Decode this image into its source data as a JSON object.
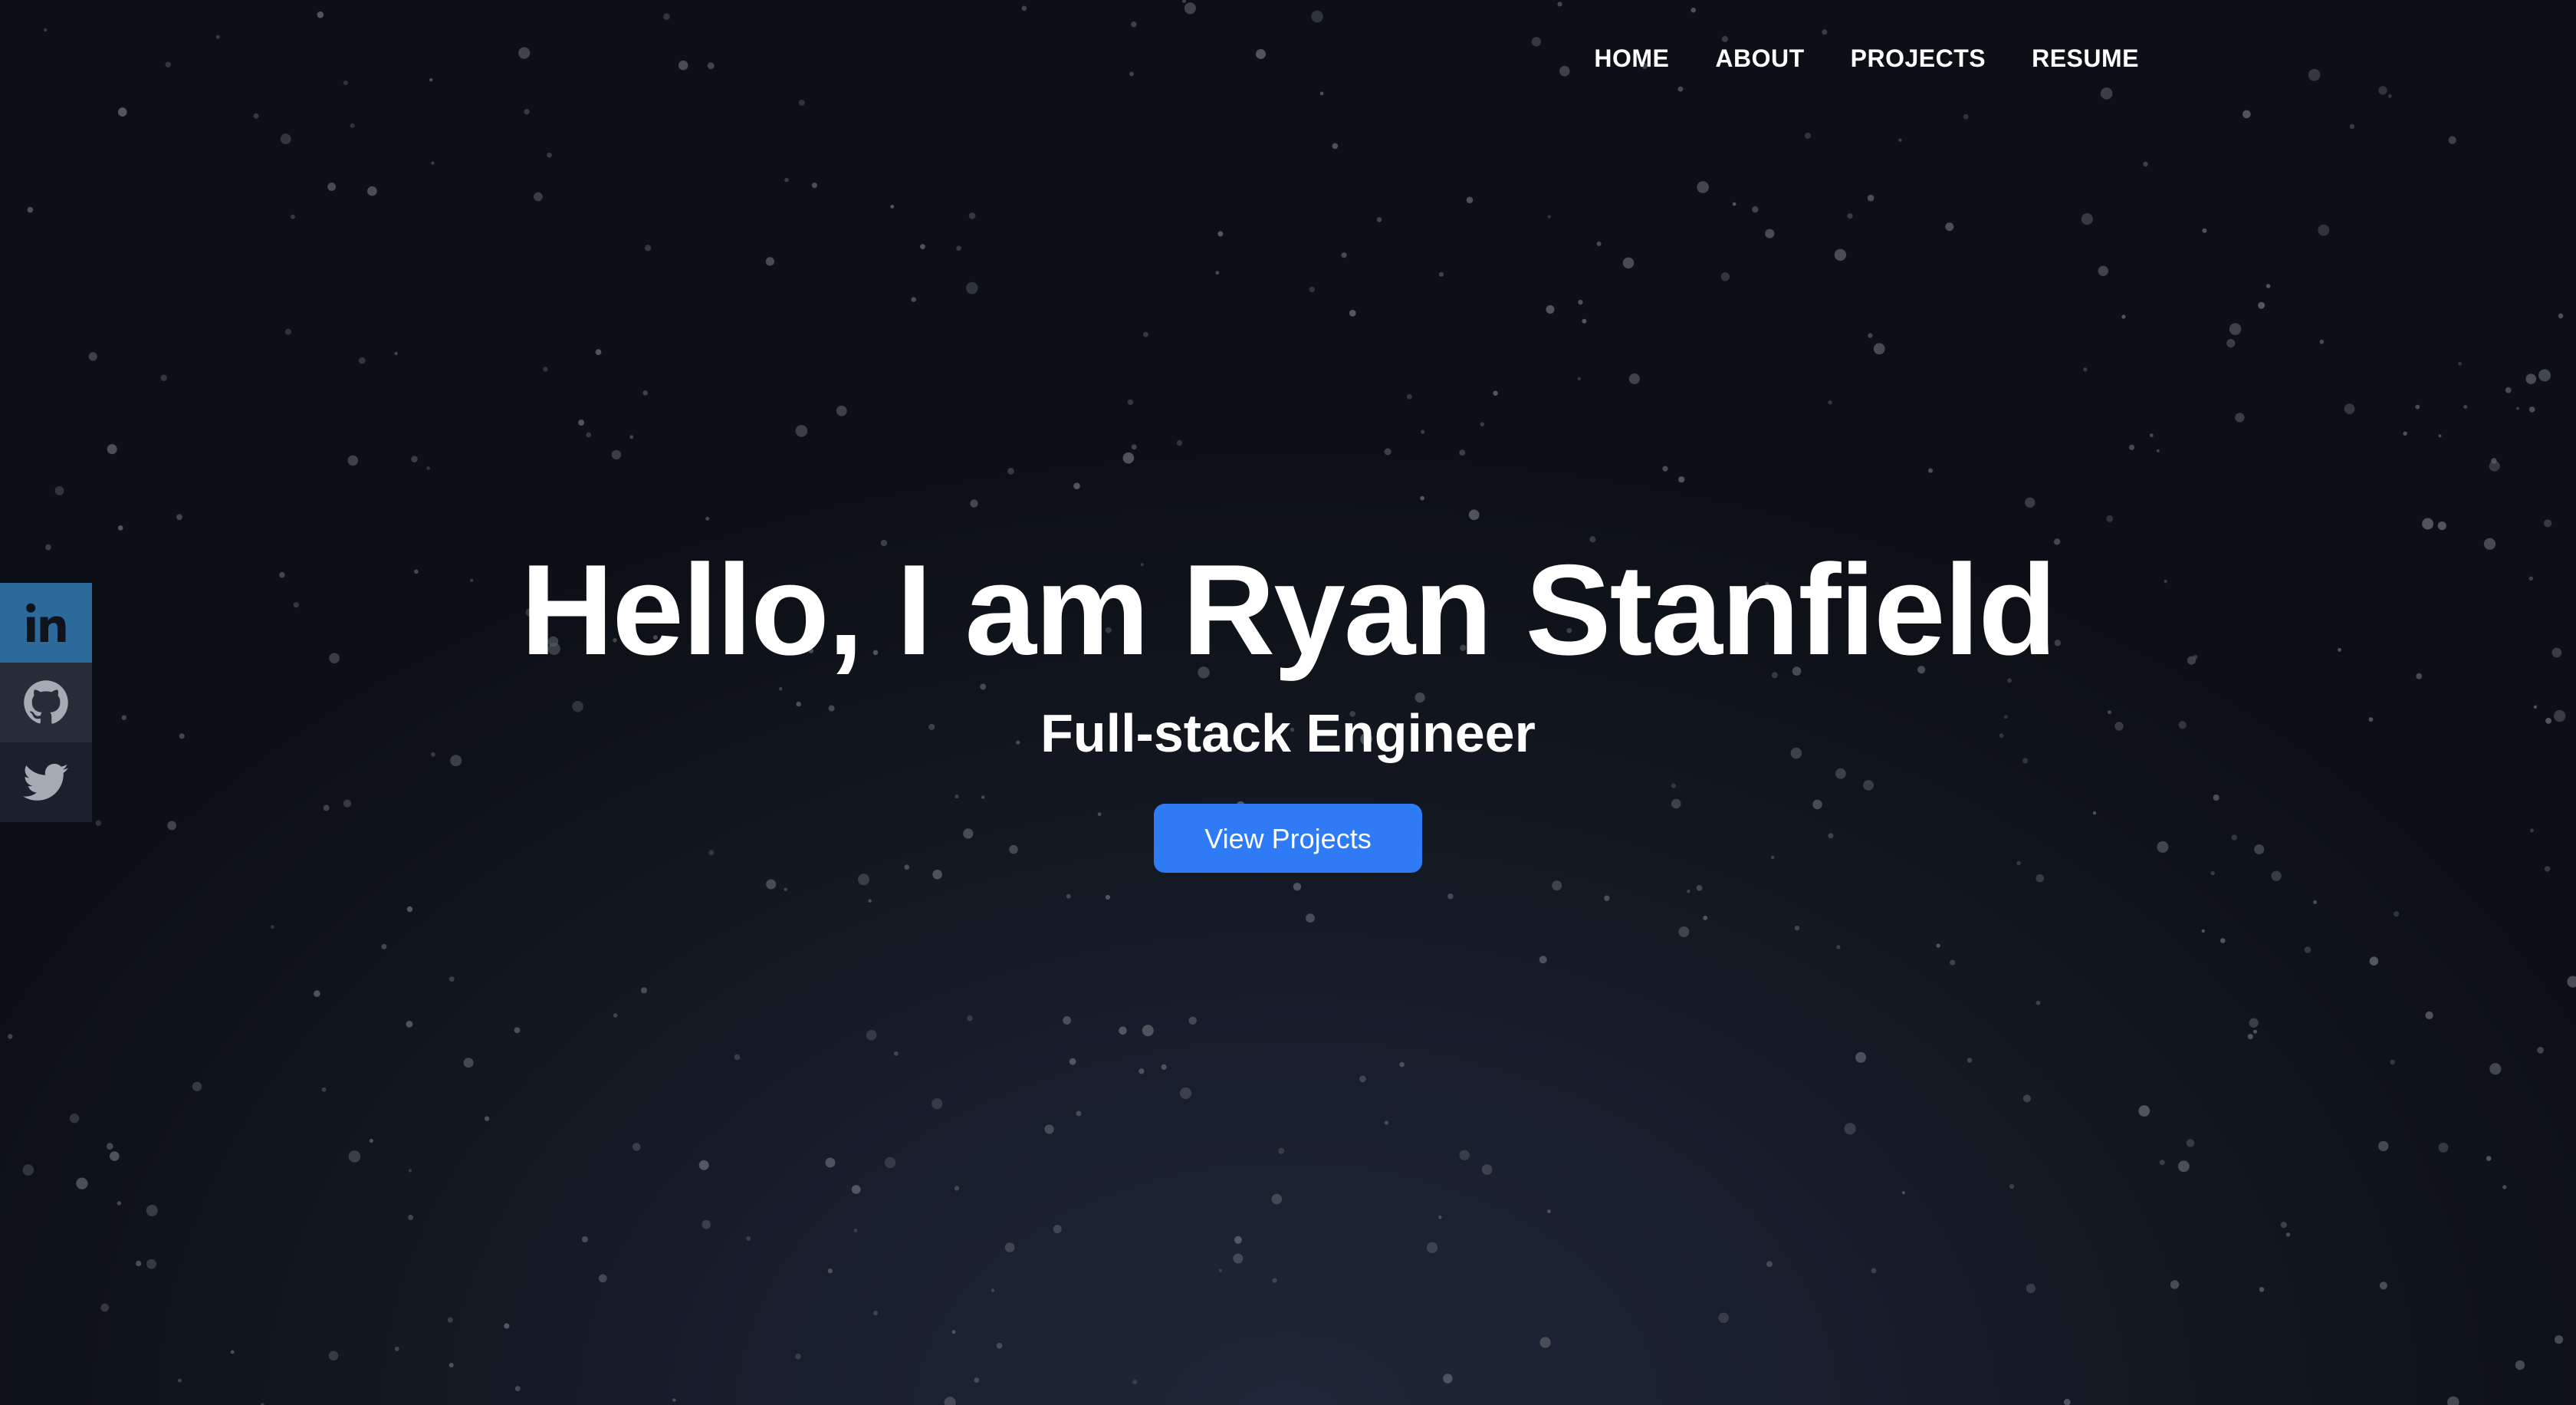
{
  "nav": {
    "items": [
      {
        "label": "HOME"
      },
      {
        "label": "ABOUT"
      },
      {
        "label": "PROJECTS"
      },
      {
        "label": "RESUME"
      }
    ]
  },
  "hero": {
    "title": "Hello, I am Ryan Stanfield",
    "subtitle": "Full-stack Engineer",
    "cta_label": "View Projects"
  },
  "social": {
    "items": [
      {
        "icon": "linkedin-icon",
        "bg": "#2d6a9c",
        "fg": "#0f131b"
      },
      {
        "icon": "github-icon",
        "bg": "#262c38",
        "fg": "#a6aab2"
      },
      {
        "icon": "twitter-icon",
        "bg": "#1a212d",
        "fg": "#a6aab2"
      }
    ]
  },
  "colors": {
    "background": "#0f131b",
    "accent": "#2f7bf5",
    "text": "#ffffff",
    "star": "#5a5f68"
  }
}
